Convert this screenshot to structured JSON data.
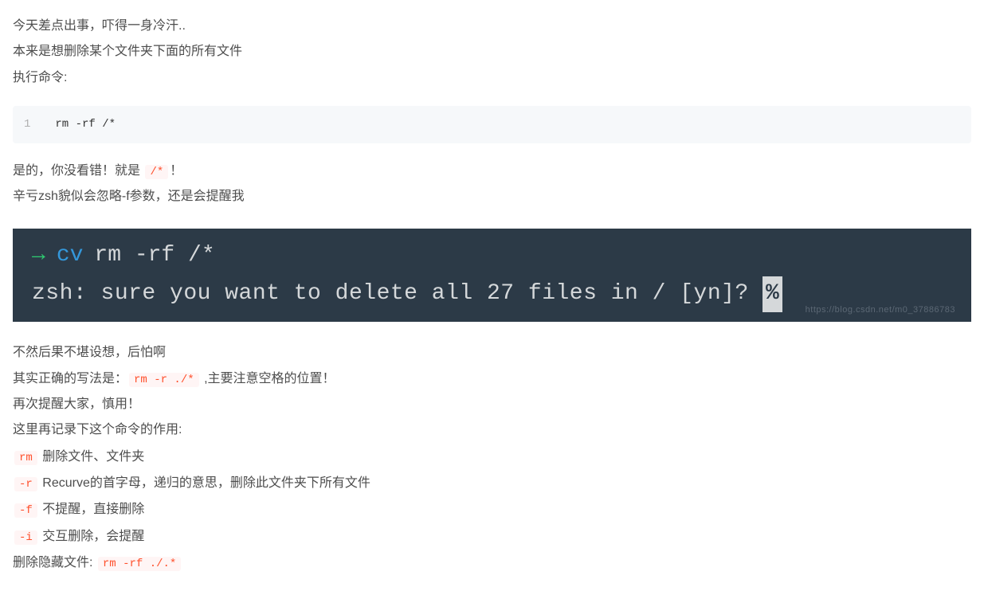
{
  "intro": {
    "p1": "今天差点出事，吓得一身冷汗..",
    "p2": "本来是想删除某个文件夹下面的所有文件",
    "p3": "执行命令:"
  },
  "codeblock1": {
    "lineNum": "1",
    "code": "rm -rf /*"
  },
  "mid1": {
    "before": "是的，你没看错！就是 ",
    "code": "/*",
    "after": "！"
  },
  "mid2": "辛亏zsh貌似会忽略-f参数，还是会提醒我",
  "terminal": {
    "arrow": "→",
    "cv": "cv",
    "cmd": "rm -rf /*",
    "line2_a": "zsh: sure you want to delete all 27 files in / [yn]? ",
    "cursor": "%",
    "watermark": "https://blog.csdn.net/m0_37886783"
  },
  "after1": "不然后果不堪设想，后怕啊",
  "after2": {
    "before": "其实正确的写法是：",
    "code": "rm -r ./*",
    "after": " ,主要注意空格的位置！"
  },
  "after3": "再次提醒大家，慎用！",
  "after4": "这里再记录下这个命令的作用:",
  "cmd_rm": {
    "code": "rm",
    "text": " 删除文件、文件夹"
  },
  "cmd_r": {
    "code": "-r",
    "text": " Recurve的首字母，递归的意思，删除此文件夹下所有文件"
  },
  "cmd_f": {
    "code": "-f",
    "text": " 不提醒，直接删除"
  },
  "cmd_i": {
    "code": "-i",
    "text": " 交互删除，会提醒"
  },
  "hidden": {
    "before": "删除隐藏文件: ",
    "code": "rm -rf ./.*"
  }
}
